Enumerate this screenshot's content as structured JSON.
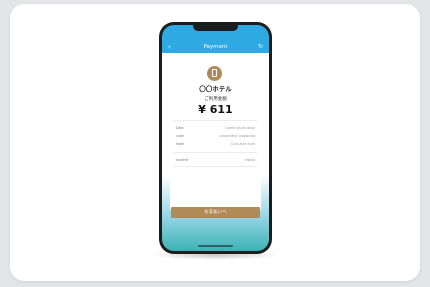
{
  "header": {
    "title": "Payment",
    "back_icon": "chevron-left-icon",
    "refresh_icon": "refresh-icon"
  },
  "hotel": {
    "logo_icon": "building-icon",
    "name": "〇〇ホテル"
  },
  "amount": {
    "label": "ご利用金額",
    "value": "¥ 611"
  },
  "details": [
    {
      "key": "Date",
      "value": "Lorem ipsum dolor"
    },
    {
      "key": "code",
      "value": "consectetur adipiscing"
    },
    {
      "key": "hotel",
      "value": "Duis aute irure"
    }
  ],
  "summary": {
    "key": "student",
    "value": "repeat"
  },
  "pay_button": {
    "label": "お支払いへ"
  },
  "colors": {
    "header": "#2fa9e2",
    "accent": "#b08a57"
  }
}
